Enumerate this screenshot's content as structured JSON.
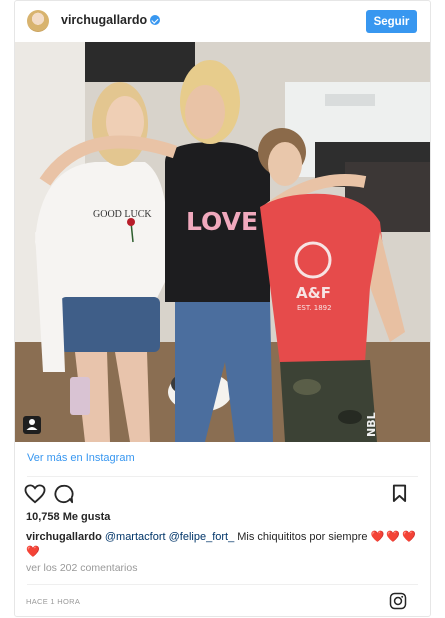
{
  "header": {
    "username": "virchugallardo",
    "follow_label": "Seguir"
  },
  "post": {
    "image_lettering": {
      "shirt_left": "GOOD LUCK",
      "shirt_center": "LOVE",
      "shirt_right": "A&F",
      "shirt_right_sub": "EST. 1892",
      "pants_right": "NBL"
    },
    "view_more_label": "Ver más en Instagram",
    "likes_label": "10,758 Me gusta",
    "caption": {
      "username": "virchugallardo",
      "mention_1": "@martacfort",
      "mention_2": "@felipe_fort_",
      "text": "Mis chiquititos por siempre",
      "emoji": "❤️❤️❤️❤️"
    },
    "comments_label": "ver los 202 comentarios",
    "timestamp": "HACE 1 HORA"
  },
  "icons": {
    "like": "heart-outline-icon",
    "comment": "comment-bubble-icon",
    "save": "bookmark-icon",
    "instagram": "instagram-logo-icon",
    "tag": "user-tag-icon"
  },
  "colors": {
    "accent": "#3897f0",
    "heart": "#ed4956"
  }
}
